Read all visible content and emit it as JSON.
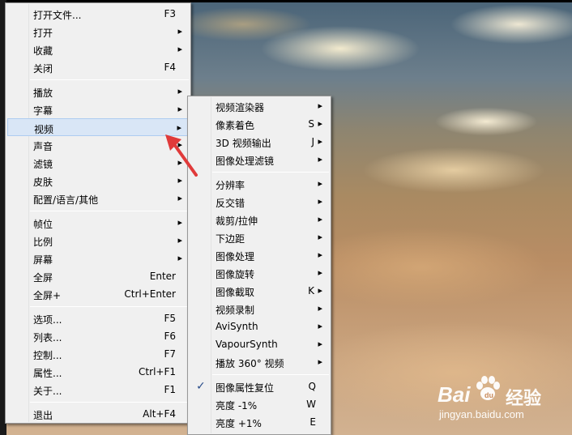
{
  "left_menu": {
    "items": [
      {
        "label": "打开文件...",
        "shortcut": "F3",
        "submenu": false
      },
      {
        "label": "打开",
        "shortcut": "",
        "submenu": true
      },
      {
        "label": "收藏",
        "shortcut": "",
        "submenu": true
      },
      {
        "label": "关闭",
        "shortcut": "F4",
        "submenu": false
      },
      {
        "label": "播放",
        "shortcut": "",
        "submenu": true
      },
      {
        "label": "字幕",
        "shortcut": "",
        "submenu": true
      },
      {
        "label": "视频",
        "shortcut": "",
        "submenu": true
      },
      {
        "label": "声音",
        "shortcut": "",
        "submenu": true
      },
      {
        "label": "滤镜",
        "shortcut": "",
        "submenu": true
      },
      {
        "label": "皮肤",
        "shortcut": "",
        "submenu": true
      },
      {
        "label": "配置/语言/其他",
        "shortcut": "",
        "submenu": true
      },
      {
        "label": "帧位",
        "shortcut": "",
        "submenu": true
      },
      {
        "label": "比例",
        "shortcut": "",
        "submenu": true
      },
      {
        "label": "屏幕",
        "shortcut": "",
        "submenu": true
      },
      {
        "label": "全屏",
        "shortcut": "Enter",
        "submenu": false
      },
      {
        "label": "全屏+",
        "shortcut": "Ctrl+Enter",
        "submenu": false
      },
      {
        "label": "选项...",
        "shortcut": "F5",
        "submenu": false
      },
      {
        "label": "列表...",
        "shortcut": "F6",
        "submenu": false
      },
      {
        "label": "控制...",
        "shortcut": "F7",
        "submenu": false
      },
      {
        "label": "属性...",
        "shortcut": "Ctrl+F1",
        "submenu": false
      },
      {
        "label": "关于...",
        "shortcut": "F1",
        "submenu": false
      },
      {
        "label": "退出",
        "shortcut": "Alt+F4",
        "submenu": false
      }
    ],
    "highlighted": "视频"
  },
  "right_menu": {
    "items": [
      {
        "label": "视频渲染器",
        "shortcut": "",
        "submenu": true
      },
      {
        "label": "像素着色",
        "shortcut": "S",
        "submenu": true
      },
      {
        "label": "3D 视频输出",
        "shortcut": "J",
        "submenu": true
      },
      {
        "label": "图像处理滤镜",
        "shortcut": "",
        "submenu": true
      },
      {
        "label": "分辨率",
        "shortcut": "",
        "submenu": true
      },
      {
        "label": "反交错",
        "shortcut": "",
        "submenu": true
      },
      {
        "label": "裁剪/拉伸",
        "shortcut": "",
        "submenu": true
      },
      {
        "label": "下边距",
        "shortcut": "",
        "submenu": true
      },
      {
        "label": "图像处理",
        "shortcut": "",
        "submenu": true
      },
      {
        "label": "图像旋转",
        "shortcut": "",
        "submenu": true
      },
      {
        "label": "图像截取",
        "shortcut": "K",
        "submenu": true
      },
      {
        "label": "视频录制",
        "shortcut": "",
        "submenu": true
      },
      {
        "label": "AviSynth",
        "shortcut": "",
        "submenu": true
      },
      {
        "label": "VapourSynth",
        "shortcut": "",
        "submenu": true
      },
      {
        "label": "播放 360° 视频",
        "shortcut": "",
        "submenu": true
      },
      {
        "label": "图像属性复位",
        "shortcut": "Q",
        "submenu": false,
        "checked": true
      },
      {
        "label": "亮度 -1%",
        "shortcut": "W",
        "submenu": false
      },
      {
        "label": "亮度 +1%",
        "shortcut": "E",
        "submenu": false
      }
    ]
  },
  "watermark": {
    "brand": "Bai",
    "brand_suffix": "经验",
    "url": "jingyan.baidu.com"
  },
  "colors": {
    "menu_bg": "#f0f0f0",
    "highlight_bg": "#d9e6f6",
    "highlight_border": "#aeccf0",
    "annotation_arrow": "#e03a3a"
  }
}
